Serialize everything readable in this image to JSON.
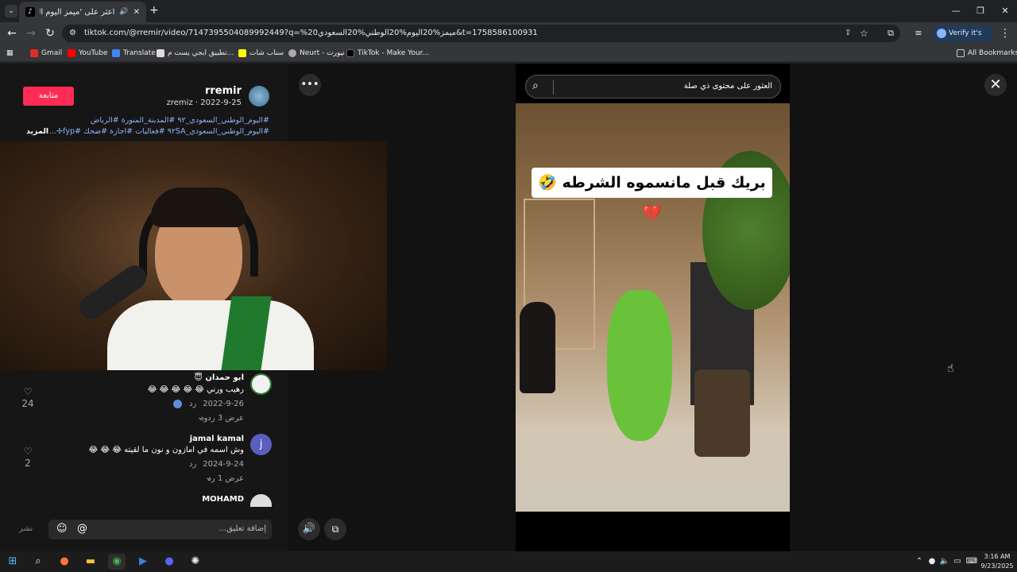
{
  "browser": {
    "tab_title": "اعثر على 'ميمز اليوم الوطني",
    "url": "tiktok.com/@rremir/video/7147395504089992449?q=%20ميمز%20اليوم%20الوطني%20السعودي&t=1758586100931",
    "verify_label": "Verify it's you",
    "bookmarks": [
      "Gmail",
      "YouTube",
      "Translate",
      "تطبيق ابجي يست م...",
      "سناب شات",
      "Neurt - نيورت",
      "TikTok - Make Your..."
    ],
    "all_bookmarks": "All Bookmarks"
  },
  "post": {
    "username": "rremir",
    "meta": "2022-9-25 · zremiz",
    "follow_label": "متابعة",
    "hashtags_line1": "#اليوم_الوطني_السعودي_٩٢ #المدينة_المنورة #الرياض",
    "hashtags_line2": "#اليوم_الوطني_السعودي_٩٢SA #فعاليات #اجازة #ضحك #fyp✢...",
    "more_label": "المزيد"
  },
  "comments": [
    {
      "name": "ابو حمدان 😇",
      "text": "رهيب ورني 😂 😂 😂 😂 😂",
      "date": "2022-9-26",
      "reply": "رد",
      "replies": "عرض 3 ردود",
      "likes": "24"
    },
    {
      "name": "jamal kamal",
      "text": "وش اسمه في امازون و نون ما لقيته 😂 😂 😂",
      "date": "2024-9-24",
      "reply": "رد",
      "replies": "عرض 1 رد",
      "likes": "2",
      "avatar_letter": "j"
    },
    {
      "name": "MOHAMD"
    }
  ],
  "composer": {
    "placeholder": "إضافة تعليق...",
    "post_label": "نشر"
  },
  "video": {
    "search_placeholder": "العثور على محتوى ذي صلة",
    "caption": "بريك قبل مانسموه الشرطه 🤣💔"
  },
  "taskbar": {
    "time": "3:16 AM",
    "date": "9/23/2025"
  },
  "colors": {
    "follow": "#fe2c55",
    "accent_link": "#8ab4f8"
  }
}
